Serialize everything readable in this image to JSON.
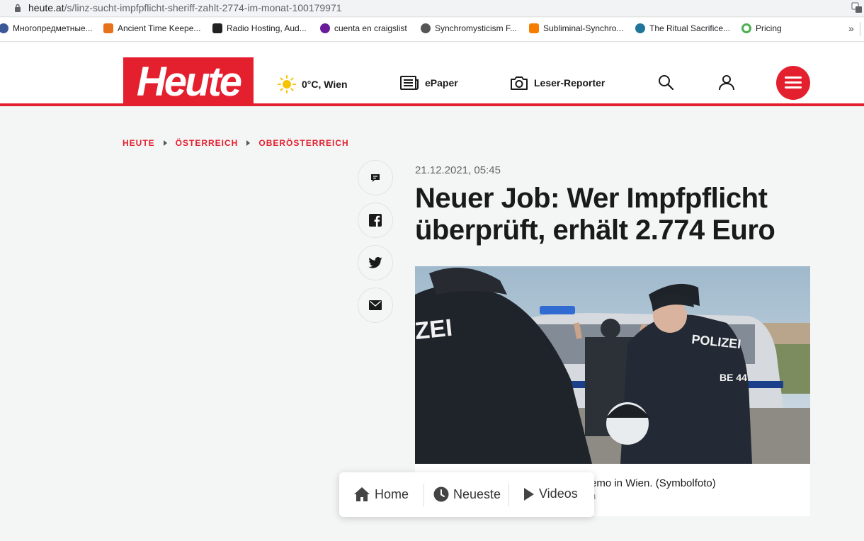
{
  "browser": {
    "url_host": "heute.at",
    "url_path": "/s/linz-sucht-impfpflicht-sheriff-zahlt-2774-im-monat-100179971",
    "bookmarks": [
      {
        "label": "Многопредметные...",
        "color": "#3b5998"
      },
      {
        "label": "Ancient Time Keepe...",
        "color": "#e8711b"
      },
      {
        "label": "Radio Hosting, Aud...",
        "color": "#222222"
      },
      {
        "label": "cuenta en craigslist",
        "color": "#6a1b9a"
      },
      {
        "label": "Synchromysticism F...",
        "color": "#555555"
      },
      {
        "label": "Subliminal-Synchro...",
        "color": "#f57d00"
      },
      {
        "label": "The Ritual Sacrifice...",
        "color": "#21759b"
      },
      {
        "label": "Pricing",
        "color": "#4caf50"
      }
    ],
    "more_label": "»"
  },
  "header": {
    "logo": "Heute",
    "weather": "0°C, Wien",
    "epaper": "ePaper",
    "reporter": "Leser-Reporter",
    "brand_color": "#e4202f"
  },
  "breadcrumbs": [
    "HEUTE",
    "ÖSTERREICH",
    "OBERÖSTERREICH"
  ],
  "article": {
    "date": "21.12.2021, 05:45",
    "title": "Neuer Job: Wer Impfpflicht überprüft, erhält 2.774 Euro",
    "caption": "emo in Wien. (Symbolfoto)",
    "credit": "n",
    "photo_text_left": "ZEI",
    "photo_text_right": "POLIZEI",
    "photo_badge": "BE 44"
  },
  "share": [
    "comment-icon",
    "facebook-icon",
    "twitter-icon",
    "mail-icon"
  ],
  "bottom_nav": {
    "home": "Home",
    "latest": "Neueste",
    "videos": "Videos"
  }
}
